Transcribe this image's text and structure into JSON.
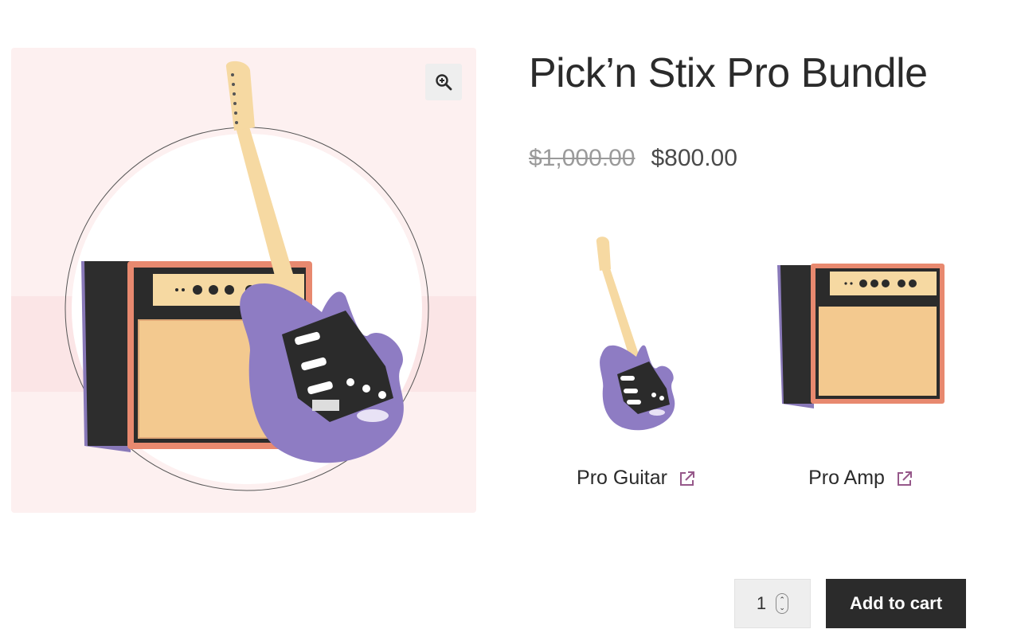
{
  "product": {
    "title": "Pick’n Stix Pro Bundle",
    "price_regular": "$1,000.00",
    "price_sale": "$800.00"
  },
  "gallery": {
    "zoom_icon": "zoom-in-icon",
    "image": "guitar-and-amp-illustration"
  },
  "bundle_items": [
    {
      "name": "Pro Guitar",
      "link_icon": "external-link-icon",
      "image": "guitar-illustration"
    },
    {
      "name": "Pro Amp",
      "link_icon": "external-link-icon",
      "image": "amp-illustration"
    }
  ],
  "cart": {
    "quantity": "1",
    "add_to_cart_label": "Add to cart"
  },
  "colors": {
    "accent": "#96588a",
    "button": "#2b2b2b",
    "guitar_body": "#8e7cc3",
    "amp_trim": "#e8896f",
    "image_bg": "#fdf0f0"
  }
}
